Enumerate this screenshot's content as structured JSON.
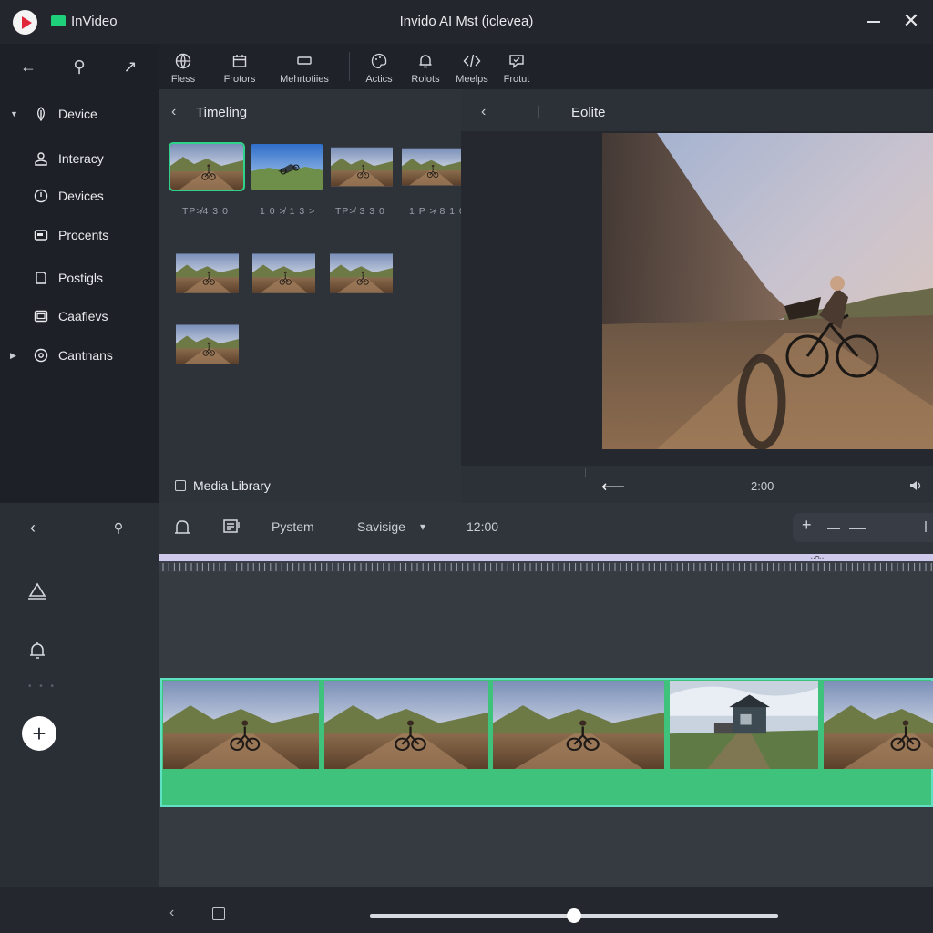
{
  "titlebar": {
    "app_name": "InVideo",
    "window_title": "Invido AI Mst (iclevea)",
    "close_glyph": "✕"
  },
  "left_nav": {
    "tools": [
      {
        "icon": "arrow-left-icon",
        "glyph": "←"
      },
      {
        "icon": "wrench-icon",
        "glyph": "⚲"
      },
      {
        "icon": "arrow-right-icon",
        "glyph": "↗"
      }
    ],
    "items": [
      {
        "label": "Device",
        "icon": "device-icon",
        "caret": "▼"
      },
      {
        "label": "Interacy",
        "icon": "user-icon"
      },
      {
        "label": "Devices",
        "icon": "clock-icon"
      },
      {
        "label": "Procents",
        "icon": "card-icon"
      },
      {
        "label": "Postigls",
        "icon": "doc-icon"
      },
      {
        "label": "Caafievs",
        "icon": "caption-icon"
      },
      {
        "label": "Cantnans",
        "icon": "settings-icon",
        "caret": "▶"
      }
    ]
  },
  "toolbar": {
    "items": [
      {
        "label": "Fless",
        "icon": "globe-icon"
      },
      {
        "label": "Frotors",
        "icon": "calendar-icon"
      },
      {
        "label": "Mehrtotiies",
        "icon": "monitor-icon"
      },
      {
        "label": "Actics",
        "icon": "palette-icon"
      },
      {
        "label": "Rolots",
        "icon": "bell-icon"
      },
      {
        "label": "Meelps",
        "icon": "code-icon"
      },
      {
        "label": "Frotut",
        "icon": "chat-icon"
      }
    ]
  },
  "media": {
    "back_glyph": "‹",
    "title": "Timeling",
    "captions": [
      "TP≯4 3 0",
      "1 0 ≯ 1 3 ˃",
      "TP≯ 3 3 0",
      "1 P ≯ 8 1 0"
    ],
    "library_label": "Media Library"
  },
  "preview": {
    "back_glyph": "‹",
    "title": "Eolite",
    "time": "2:00",
    "rewind_glyph": "⟵"
  },
  "timeline_toolbar": {
    "label_1": "Pystem",
    "dropdown_value": "Savisige",
    "dropdown_caret": "▾",
    "time": "12:00",
    "zoom_plus": "+"
  },
  "lower_left": {
    "back_glyph": "‹",
    "pen_glyph": "⚲",
    "add_glyph": "+",
    "dots": "• • •"
  },
  "ruler": {
    "marker": "ᴗᴑᴗ"
  },
  "bottom": {
    "back_glyph": "‹",
    "scrub_position": 0.5
  },
  "colors": {
    "accent_green": "#3ec27c",
    "track_border": "#5fe0c2",
    "ruler_band": "#cfc9ec",
    "logo_red": "#e2263a"
  }
}
